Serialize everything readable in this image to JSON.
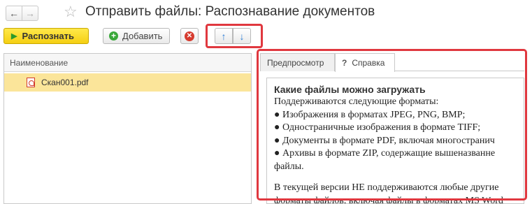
{
  "window": {
    "title": "Отправить файлы: Распознавание документов",
    "back_icon": "←",
    "forward_icon": "→",
    "favorite_icon": "☆"
  },
  "toolbar": {
    "recognize_label": "Распознать",
    "add_label": "Добавить",
    "delete_icon": "✕",
    "up_icon": "🡅",
    "down_icon": "🡇"
  },
  "file_list": {
    "column_header": "Наименование",
    "rows": [
      {
        "name": "Скан001.pdf",
        "icon": "pdf-icon"
      }
    ]
  },
  "tabs": [
    {
      "label": "Предпросмотр"
    },
    {
      "label": "Справка",
      "icon": "?"
    }
  ],
  "help": {
    "heading": "Какие файлы можно загружать",
    "lines": [
      "Поддерживаются следующие форматы:",
      "● Изображения в форматах JPEG, PNG, BMP;",
      "● Одностраничные изображения в формате TIFF;",
      "● Документы в формате PDF, включая многостранич",
      "● Архивы в формате ZIP, содержащие вышеназванне",
      "файлы."
    ],
    "lines2": [
      "В текущей версии НЕ поддерживаются любые другие",
      "форматы файлов, включая файлы в форматах MS Word"
    ]
  },
  "colors": {
    "highlight_frame": "#e0383f",
    "selected_row": "#fbe59a",
    "primary_button": "#f5cf12"
  }
}
